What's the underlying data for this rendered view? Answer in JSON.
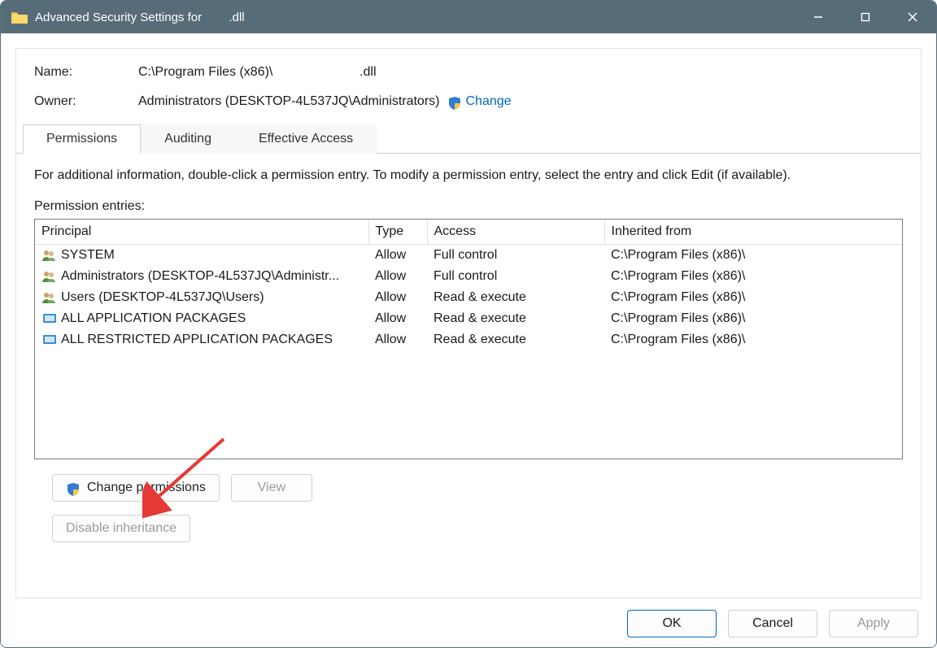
{
  "titlebar": {
    "prefix": "Advanced Security Settings for ",
    "filename": "       .dll"
  },
  "info": {
    "name_label": "Name:",
    "name_value": "C:\\Program Files (x86)\\                        .dll",
    "owner_label": "Owner:",
    "owner_value": "Administrators (DESKTOP-4L537JQ\\Administrators)",
    "change_link": "Change"
  },
  "tabs": {
    "permissions": "Permissions",
    "auditing": "Auditing",
    "effective": "Effective Access"
  },
  "body": {
    "help": "For additional information, double-click a permission entry. To modify a permission entry, select the entry and click Edit (if available).",
    "entries_label": "Permission entries:"
  },
  "table": {
    "headers": {
      "principal": "Principal",
      "type": "Type",
      "access": "Access",
      "inherited": "Inherited from"
    },
    "rows": [
      {
        "icon": "users",
        "principal": "SYSTEM",
        "type": "Allow",
        "access": "Full control",
        "inherited": "C:\\Program Files (x86)\\"
      },
      {
        "icon": "users",
        "principal": "Administrators (DESKTOP-4L537JQ\\Administr...",
        "type": "Allow",
        "access": "Full control",
        "inherited": "C:\\Program Files (x86)\\"
      },
      {
        "icon": "users",
        "principal": "Users (DESKTOP-4L537JQ\\Users)",
        "type": "Allow",
        "access": "Read & execute",
        "inherited": "C:\\Program Files (x86)\\"
      },
      {
        "icon": "pkg",
        "principal": "ALL APPLICATION PACKAGES",
        "type": "Allow",
        "access": "Read & execute",
        "inherited": "C:\\Program Files (x86)\\"
      },
      {
        "icon": "pkg",
        "principal": "ALL RESTRICTED APPLICATION PACKAGES",
        "type": "Allow",
        "access": "Read & execute",
        "inherited": "C:\\Program Files (x86)\\"
      }
    ]
  },
  "buttons": {
    "change_perm": "Change permissions",
    "view": "View",
    "disable_inh": "Disable inheritance",
    "ok": "OK",
    "cancel": "Cancel",
    "apply": "Apply"
  }
}
